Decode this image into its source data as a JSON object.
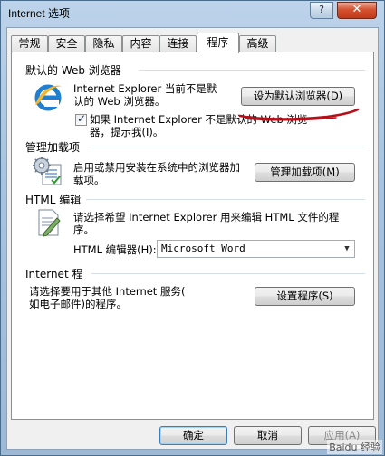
{
  "window": {
    "title": "Internet 选项",
    "help_glyph": "?",
    "close_glyph": "✕"
  },
  "tabs": [
    {
      "label": "常规"
    },
    {
      "label": "安全"
    },
    {
      "label": "隐私"
    },
    {
      "label": "内容"
    },
    {
      "label": "连接"
    },
    {
      "label": "程序"
    },
    {
      "label": "高级"
    }
  ],
  "default_browser": {
    "group_label": "默认的 Web 浏览器",
    "status_line1": "Internet Explorer 当前不是默",
    "status_line2": "认的 Web 浏览器。",
    "set_default_button": "设为默认浏览器(D)",
    "check_label_line1": "如果 Internet Explorer 不是默认的 Web 浏览",
    "check_label_line2": "器，提示我(I)。",
    "check_checked": true,
    "icon": "ie-icon"
  },
  "addons": {
    "group_label": "管理加载项",
    "desc_line1": "启用或禁用安装在系统中的浏览器加",
    "desc_line2": "载项。",
    "button": "管理加载项(M)",
    "icon": "addons-gear-icon"
  },
  "html_editing": {
    "group_label": "HTML 编辑",
    "desc_line1": "请选择希望 Internet Explorer 用来编辑 HTML 文件的程",
    "desc_line2": "序。",
    "editor_label": "HTML 编辑器(H):",
    "editor_value": "Microsoft Word",
    "icon": "document-pen-icon"
  },
  "internet_programs": {
    "group_label": "Internet 程",
    "desc_line1": "请选择要用于其他 Internet 服务(",
    "desc_line2": "如电子邮件)的程序。",
    "button": "设置程序(S)"
  },
  "footer": {
    "ok": "确定",
    "cancel": "取消",
    "apply": "应用(A)"
  },
  "watermark": "Baidu 经验",
  "colors": {
    "annotation": "#b4101a"
  }
}
